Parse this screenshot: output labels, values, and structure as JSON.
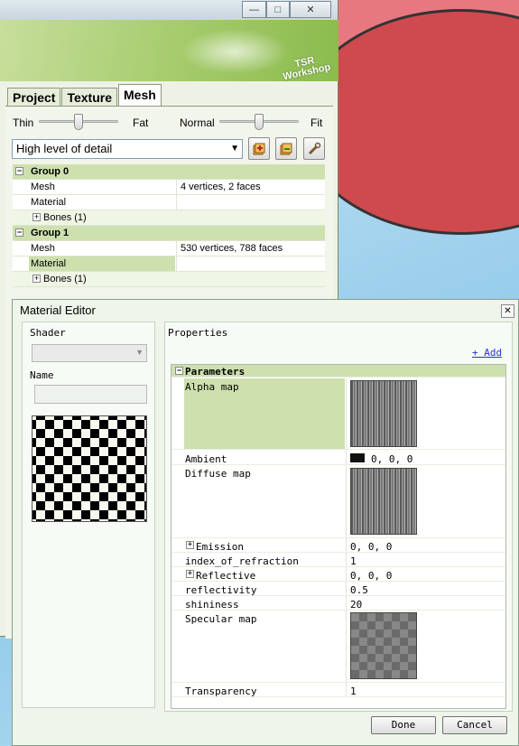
{
  "main_window": {
    "tabs": [
      {
        "label": "Project",
        "active": false
      },
      {
        "label": "Texture",
        "active": false
      },
      {
        "label": "Mesh",
        "active": true
      }
    ],
    "logo_text": {
      "line1": "TSR",
      "line2": "Workshop"
    },
    "sliders": [
      {
        "left_label": "Thin",
        "right_label": "Fat",
        "value_fraction": 0.55
      },
      {
        "left_label": "Normal",
        "right_label": "Fit",
        "value_fraction": 0.5
      }
    ],
    "detail_select": {
      "value": "High level of detail"
    },
    "tool_icons": [
      "import-mesh-icon",
      "export-mesh-icon",
      "wrench-icon"
    ],
    "mesh_groups": [
      {
        "name": "Group 0",
        "rows": [
          {
            "label": "Mesh",
            "value": "4 vertices, 2 faces"
          },
          {
            "label": "Material",
            "value": "",
            "selected": false
          },
          {
            "label": "Bones (1)",
            "expandable": true
          }
        ]
      },
      {
        "name": "Group 1",
        "rows": [
          {
            "label": "Mesh",
            "value": "530 vertices, 788 faces"
          },
          {
            "label": "Material",
            "value": "",
            "selected": true
          },
          {
            "label": "Bones (1)",
            "expandable": true
          }
        ]
      }
    ],
    "window_buttons": {
      "min": "—",
      "max": "□",
      "close": "✕"
    }
  },
  "material_editor": {
    "title": "Material Editor",
    "close": "✕",
    "shader_label": "Shader",
    "shader_value": "",
    "name_label": "Name",
    "name_value": "",
    "properties_label": "Properties",
    "add_link": "+ Add",
    "section_title": "Parameters",
    "params": [
      {
        "key": "Alpha map",
        "type": "texture",
        "texture": "noise"
      },
      {
        "key": "Ambient",
        "value": "0, 0, 0",
        "swatch": "#111111"
      },
      {
        "key": "Diffuse map",
        "type": "texture",
        "texture": "noise"
      },
      {
        "key": "Emission",
        "value": "0, 0, 0",
        "expandable": true
      },
      {
        "key": "index_of_refraction",
        "value": "1"
      },
      {
        "key": "Reflective",
        "value": "0, 0, 0",
        "expandable": true
      },
      {
        "key": "reflectivity",
        "value": "0.5"
      },
      {
        "key": "shininess",
        "value": "20"
      },
      {
        "key": "Specular map",
        "type": "texture",
        "texture": "checker"
      },
      {
        "key": "Transparency",
        "value": "1"
      }
    ],
    "buttons": {
      "done": "Done",
      "cancel": "Cancel"
    }
  },
  "colors": {
    "accent_green": "#cde0ae",
    "banner_green": "#a7cc6e",
    "background_red": "#e85a5f"
  }
}
